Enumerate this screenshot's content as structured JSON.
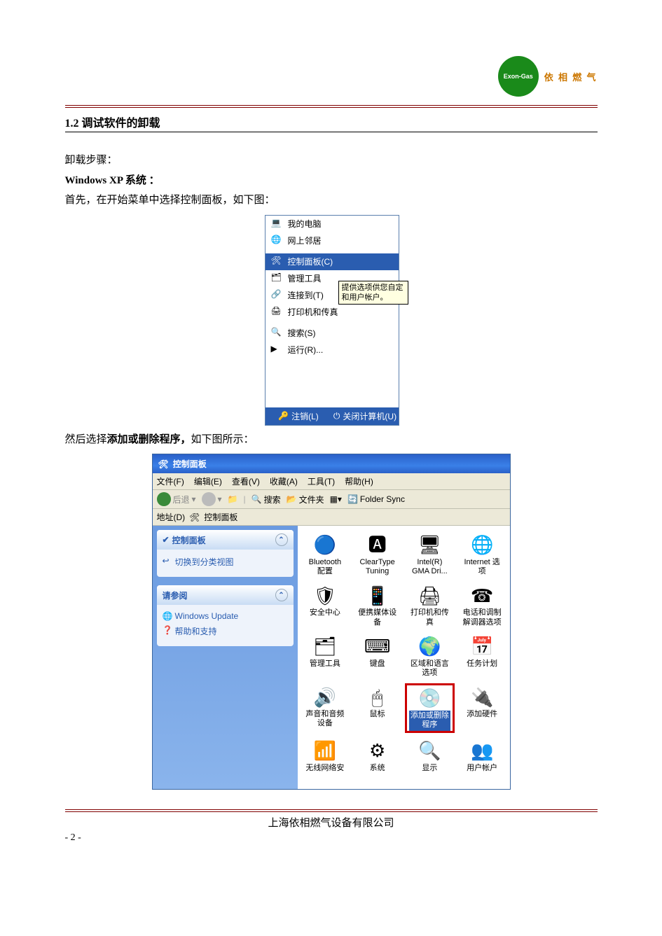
{
  "logo": {
    "circle_text": "Exon-Gas",
    "brand_text": "依 相 燃 气"
  },
  "section": {
    "number_title": "1.2 调试软件的卸载"
  },
  "body": {
    "line1": "卸载步骤：",
    "line2_bold": "Windows XP 系统 ：",
    "line3": "首先，在开始菜单中选择控制面板，如下图：",
    "line4_pre": "然后选择",
    "line4_bold": "添加或删除程序，",
    "line4_post": "如下图所示："
  },
  "startmenu": {
    "items": [
      {
        "icon": "💻",
        "label": "我的电脑"
      },
      {
        "icon": "🌐",
        "label": "网上邻居"
      }
    ],
    "selected": {
      "icon": "🛠",
      "label": "控制面板(C)"
    },
    "below": [
      {
        "icon": "🗂",
        "label": "管理工具"
      },
      {
        "icon": "🔗",
        "label": "连接到(T)"
      },
      {
        "icon": "🖨",
        "label": "打印机和传真"
      }
    ],
    "sep2": [
      {
        "icon": "🔍",
        "label": "搜索(S)"
      },
      {
        "icon": "▶",
        "label": "运行(R)..."
      }
    ],
    "tooltip": "提供选项供您自定\n和用户帐户。",
    "logoff": "注销(L)",
    "shutdown": "关闭计算机(U)"
  },
  "cpanel": {
    "title": "控制面板",
    "menu": [
      "文件(F)",
      "编辑(E)",
      "查看(V)",
      "收藏(A)",
      "工具(T)",
      "帮助(H)"
    ],
    "toolbar": {
      "back": "后退",
      "search": "搜索",
      "folders": "文件夹",
      "foldersync": "Folder Sync"
    },
    "address_label": "地址(D)",
    "address_value": "控制面板",
    "side": {
      "panel1_title": "控制面板",
      "panel1_link": "切换到分类视图",
      "panel2_title": "请参阅",
      "panel2_links": [
        "Windows Update",
        "帮助和支持"
      ]
    },
    "icons": [
      {
        "glyph": "🔵",
        "label": "Bluetooth\n配置"
      },
      {
        "glyph": "🅰",
        "label": "ClearType\nTuning"
      },
      {
        "glyph": "🖥",
        "label": "Intel(R)\nGMA Dri..."
      },
      {
        "glyph": "🌐",
        "label": "Internet 选\n项"
      },
      {
        "glyph": "🛡",
        "label": "安全中心"
      },
      {
        "glyph": "📱",
        "label": "便携媒体设\n备"
      },
      {
        "glyph": "🖨",
        "label": "打印机和传\n真"
      },
      {
        "glyph": "☎",
        "label": "电话和调制\n解调器选项"
      },
      {
        "glyph": "🗂",
        "label": "管理工具"
      },
      {
        "glyph": "⌨",
        "label": "键盘"
      },
      {
        "glyph": "🌍",
        "label": "区域和语言\n选项"
      },
      {
        "glyph": "📅",
        "label": "任务计划"
      },
      {
        "glyph": "🔊",
        "label": "声音和音频\n设备"
      },
      {
        "glyph": "🖱",
        "label": "鼠标"
      },
      {
        "glyph": "💿",
        "label": "添加或删除\n程序",
        "highlight": true
      },
      {
        "glyph": "🔌",
        "label": "添加硬件"
      },
      {
        "glyph": "📶",
        "label": "无线网络安"
      },
      {
        "glyph": "⚙",
        "label": "系统"
      },
      {
        "glyph": "🔍",
        "label": "显示"
      },
      {
        "glyph": "👥",
        "label": "用户帐户"
      }
    ]
  },
  "footer": {
    "company": "上海依相燃气设备有限公司",
    "page": "- 2 -"
  }
}
